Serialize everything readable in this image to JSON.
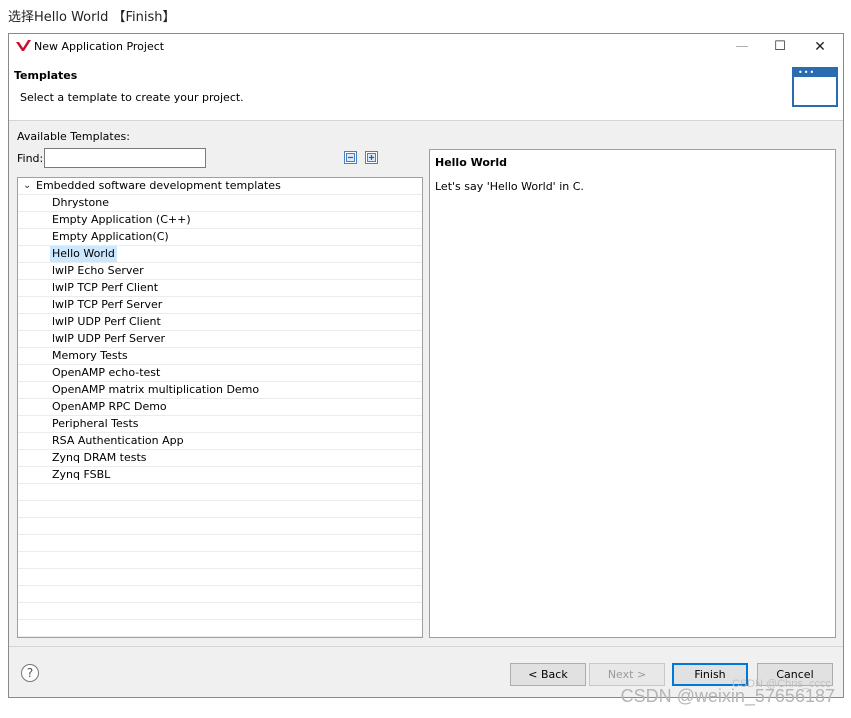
{
  "caption": "选择Hello World 【Finish】",
  "window": {
    "title": "New Application Project",
    "controls": {
      "minimize": "—",
      "maximize": "☐",
      "close": "✕"
    }
  },
  "header": {
    "title": "Templates",
    "description": "Select a template to create your project."
  },
  "templates": {
    "available_label": "Available Templates:",
    "find_label": "Find:",
    "find_value": "",
    "root": "Embedded software development templates",
    "items": [
      "Dhrystone",
      "Empty Application (C++)",
      "Empty Application(C)",
      "Hello World",
      "lwIP Echo Server",
      "lwIP TCP Perf Client",
      "lwIP TCP Perf Server",
      "lwIP UDP Perf Client",
      "lwIP UDP Perf Server",
      "Memory Tests",
      "OpenAMP echo-test",
      "OpenAMP matrix multiplication Demo",
      "OpenAMP RPC Demo",
      "Peripheral Tests",
      "RSA Authentication App",
      "Zynq DRAM tests",
      "Zynq FSBL"
    ],
    "selected": "Hello World"
  },
  "description": {
    "title": "Hello World",
    "text": "Let's say 'Hello World' in C."
  },
  "buttons": {
    "help": "?",
    "back": "< Back",
    "next": "Next >",
    "finish": "Finish",
    "cancel": "Cancel"
  },
  "watermark": {
    "main": "CSDN @weixin_57656187",
    "small": "CSDN @Chris_cccc"
  },
  "colors": {
    "accent": "#0078d7",
    "selection": "#cce8ff",
    "wizard_icon": "#2b6cb0",
    "logo": "#c8102e"
  }
}
